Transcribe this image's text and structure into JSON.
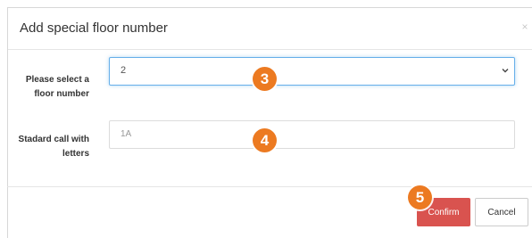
{
  "dialog": {
    "title": "Add special floor number",
    "close_symbol": "×"
  },
  "form": {
    "floor_label": "Please select a floor number",
    "floor_value": "2",
    "call_label": "Stadard call with letters",
    "call_value": "1A"
  },
  "footer": {
    "confirm_label": "Confirm",
    "cancel_label": "Cancel"
  },
  "steps": {
    "s3": "3",
    "s4": "4",
    "s5": "5"
  },
  "colors": {
    "confirm": "#d9534f",
    "step_badge": "#ec7a21",
    "focus_border": "#66afe9"
  },
  "icons": [
    "close-icon",
    "chevron-down-icon"
  ]
}
